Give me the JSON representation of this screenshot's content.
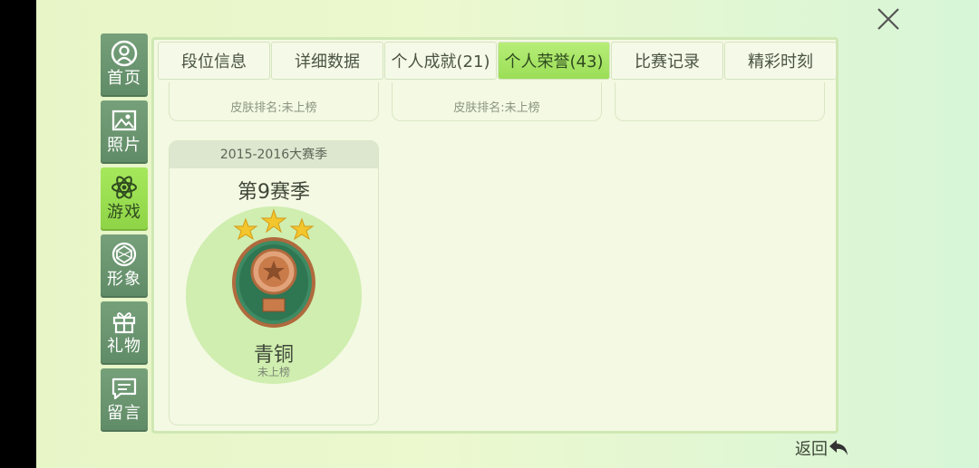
{
  "sidebar": {
    "items": [
      {
        "label": "首页",
        "icon": "user-circle-icon"
      },
      {
        "label": "照片",
        "icon": "photo-icon"
      },
      {
        "label": "游戏",
        "icon": "atom-icon",
        "active": true
      },
      {
        "label": "形象",
        "icon": "gem-icon"
      },
      {
        "label": "礼物",
        "icon": "gift-icon"
      },
      {
        "label": "留言",
        "icon": "message-icon"
      }
    ]
  },
  "tabs": [
    {
      "label": "段位信息"
    },
    {
      "label": "详细数据"
    },
    {
      "label": "个人成就(21)"
    },
    {
      "label": "个人荣誉(43)",
      "active": true
    },
    {
      "label": "比赛记录"
    },
    {
      "label": "精彩时刻"
    }
  ],
  "top_cards": [
    {
      "rank": "皮肤排名:未上榜"
    },
    {
      "rank": "皮肤排名:未上榜"
    },
    {
      "rank": ""
    }
  ],
  "season_card": {
    "header": "2015-2016大赛季",
    "title": "第9赛季",
    "tier": "青铜",
    "status": "未上榜",
    "stars": 3
  },
  "back_label": "返回",
  "colors": {
    "accent_green": "#9bde57",
    "sidebar_green": "#6a966f",
    "medal_bronze": "#c97b4a",
    "medal_green": "#3e8a63"
  }
}
